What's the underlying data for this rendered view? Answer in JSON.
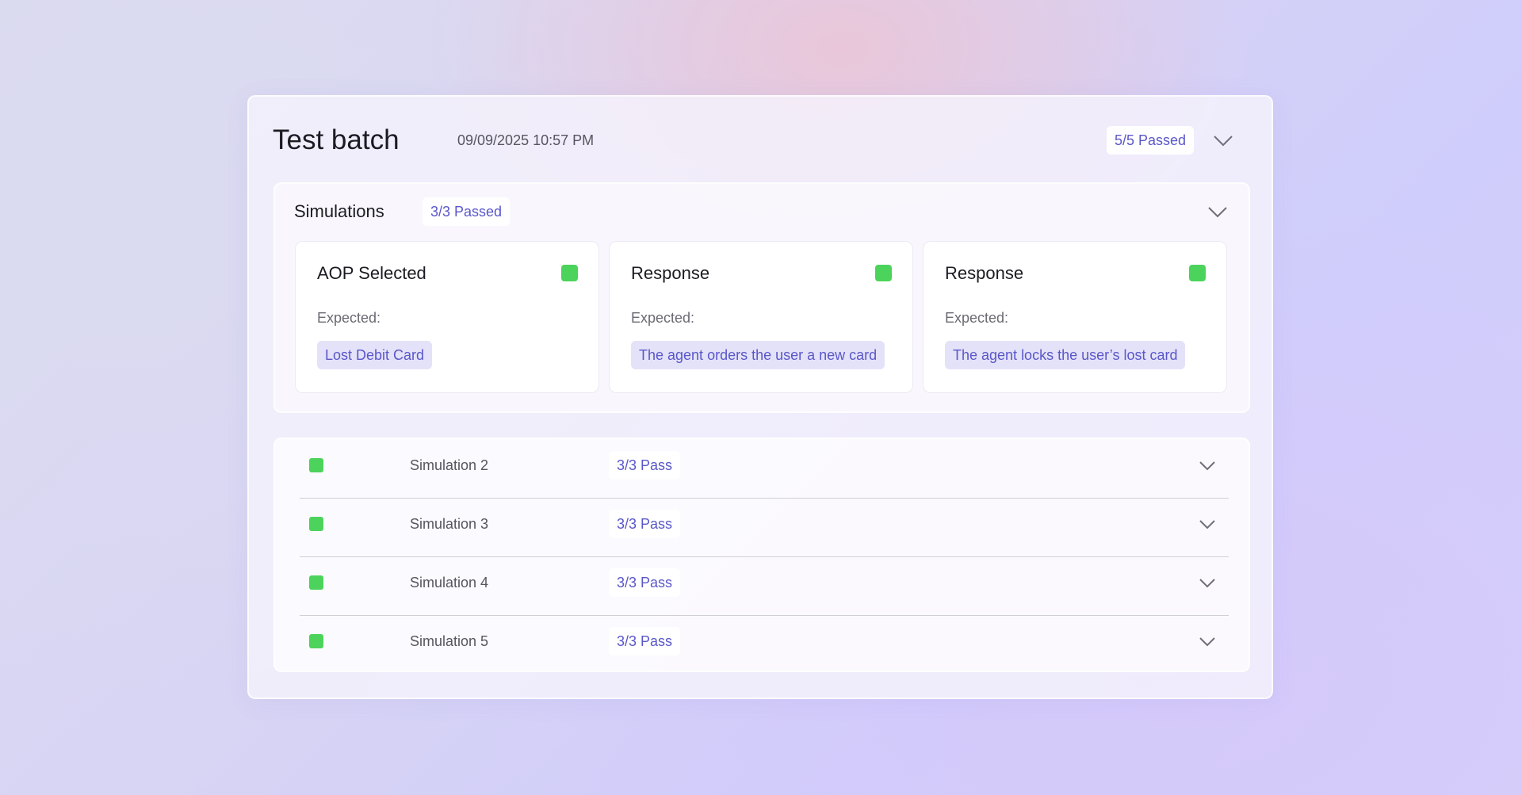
{
  "batch": {
    "title": "Test batch",
    "date": "09/09/2025 10:57 PM",
    "summary_badge": "5/5 Passed",
    "chevron_icon": "chevron-down-icon"
  },
  "simulations": {
    "title": "Simulations",
    "badge": "3/3 Passed",
    "chevron_icon": "chevron-down-icon",
    "cards": [
      {
        "title": "AOP Selected",
        "status": "passed",
        "expected_label": "Expected:",
        "expected_value": "Lost Debit Card"
      },
      {
        "title": "Response",
        "status": "passed",
        "expected_label": "Expected:",
        "expected_value": "The agent orders the user a new card"
      },
      {
        "title": "Response",
        "status": "passed",
        "expected_label": "Expected:",
        "expected_value": "The agent locks the user’s lost card"
      }
    ]
  },
  "simulation_list": [
    {
      "label": "Simulation 2",
      "badge": "3/3 Pass",
      "status": "passed"
    },
    {
      "label": "Simulation 3",
      "badge": "3/3 Pass",
      "status": "passed"
    },
    {
      "label": "Simulation 4",
      "badge": "3/3 Pass",
      "status": "passed"
    },
    {
      "label": "Simulation 5",
      "badge": "3/3 Pass",
      "status": "passed"
    }
  ],
  "colors": {
    "pass_green": "#4cd35b",
    "accent_text": "#5a57c9",
    "chip_background": "#e4e2f8"
  }
}
